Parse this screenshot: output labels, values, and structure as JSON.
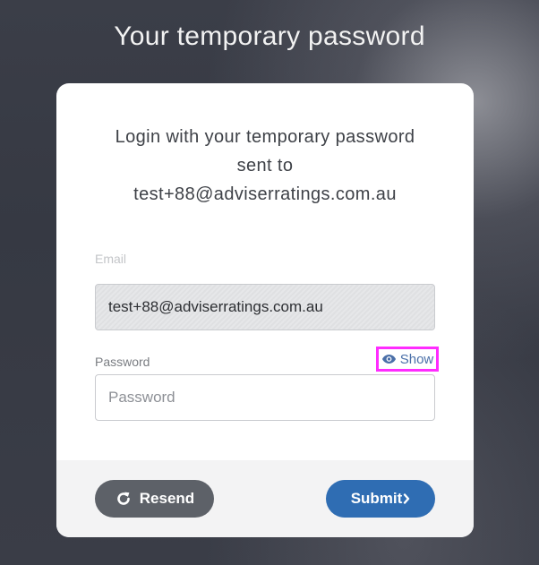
{
  "page": {
    "title": "Your temporary password"
  },
  "card": {
    "intro_line1": "Login with your temporary password",
    "intro_line2": "sent to",
    "intro_line3": "test+88@adviserratings.com.au"
  },
  "form": {
    "email_label": "Email",
    "email_value": "test+88@adviserratings.com.au",
    "password_label": "Password",
    "password_placeholder": "Password",
    "password_value": "",
    "show_label": "Show",
    "show_icon": "eye-icon"
  },
  "footer": {
    "resend_label": "Resend",
    "resend_icon": "refresh-icon",
    "submit_label": "Submit",
    "submit_icon": "chevron-right-icon"
  },
  "colors": {
    "submit_button": "#2f6db3",
    "resend_button": "#5d6168",
    "highlight_border": "#ff2cff",
    "link_blue": "#4a6fa8"
  }
}
